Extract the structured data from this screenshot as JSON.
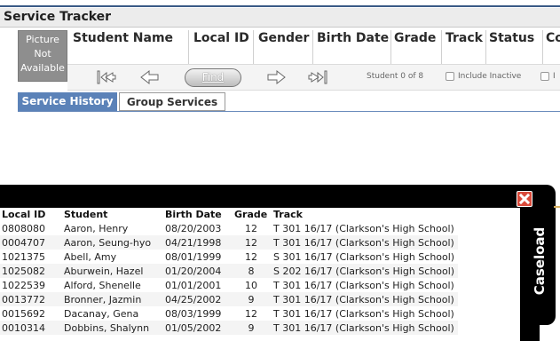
{
  "window": {
    "title": "Service Tracker"
  },
  "photo": {
    "line1": "Picture",
    "line2": "Not",
    "line3": "Available"
  },
  "columns": [
    "Student Name",
    "Local ID",
    "Gender",
    "Birth Date",
    "Grade",
    "Track",
    "Status",
    "Co"
  ],
  "navigation": {
    "first_icon": "first-record-icon",
    "prev_icon": "previous-arrow-icon",
    "find_label": "Find",
    "next_icon": "next-arrow-icon",
    "last_icon": "last-record-icon",
    "student_count": "Student 0 of 8",
    "include_inactive_label": "Include Inactive",
    "second_checkbox_label": "I"
  },
  "tabs": [
    {
      "label": "Service History",
      "active": true
    },
    {
      "label": "Group Services",
      "active": false
    }
  ],
  "caseload": {
    "title": "Caseload",
    "close_icon": "close-icon",
    "headers": [
      "Local ID",
      "Student",
      "Birth Date",
      "Grade",
      "Track"
    ],
    "rows": [
      [
        "0808080",
        "Aaron, Henry",
        "08/20/2003",
        "12",
        "T 301 16/17 (Clarkson's High School)"
      ],
      [
        "0004707",
        "Aaron, Seung-hyo",
        "04/21/1998",
        "12",
        "T 301 16/17 (Clarkson's High School)"
      ],
      [
        "1021375",
        "Abell, Amy",
        "08/01/1999",
        "12",
        "S 301 16/17 (Clarkson's High School)"
      ],
      [
        "1025082",
        "Aburwein, Hazel",
        "01/20/2004",
        "8",
        "S 202 16/17 (Clarkson's High School)"
      ],
      [
        "1022539",
        "Alford, Shenelle",
        "01/01/2001",
        "10",
        "T 301 16/17 (Clarkson's High School)"
      ],
      [
        "0013772",
        "Bronner, Jazmin",
        "04/25/2002",
        "9",
        "T 301 16/17 (Clarkson's High School)"
      ],
      [
        "0015692",
        "Dacanay, Gena",
        "08/03/1999",
        "12",
        "T 301 16/17 (Clarkson's High School)"
      ],
      [
        "0010314",
        "Dobbins, Shalynn",
        "01/05/2002",
        "9",
        "T 301 16/17 (Clarkson's High School)"
      ]
    ]
  },
  "colors": {
    "tab_active": "#5b82b8",
    "overlay": "#000000",
    "close_button": "#d94a3a"
  }
}
